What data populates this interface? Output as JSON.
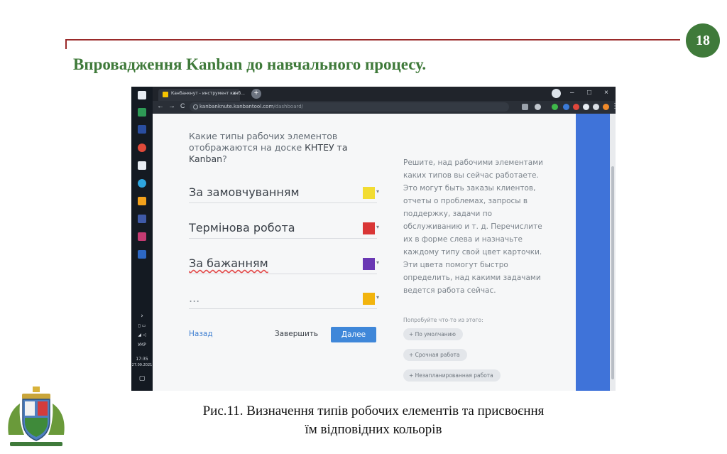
{
  "slide": {
    "number": "18",
    "title": "Впровадження Kanban до навчального процесу.",
    "caption_line1": "Рис.11. Визначення типів робочих елементів та присвоєння",
    "caption_line2": "їм відповідних кольорів"
  },
  "taskbar": {
    "tray_lang": "УКР",
    "clock_time": "17:35",
    "clock_date": "27.09.2021"
  },
  "browser": {
    "tab_title": "Канбанкнут - инструмент канб...",
    "tab_close": "×",
    "new_tab": "+",
    "url_prefix": "kanbanknute.kanbantool.com",
    "url_path": "/dashboard/",
    "controls": {
      "minimize": "–",
      "maximize": "□",
      "close": "×"
    },
    "nav": {
      "back": "←",
      "forward": "→",
      "reload": "C"
    }
  },
  "wizard": {
    "question_part1": "Какие типы рабочих элементов отображаются на доске ",
    "question_board": "КНТЕУ та Kanban",
    "question_end": "?",
    "types": [
      {
        "label": "За замовчуванням",
        "color": "#f2dc32"
      },
      {
        "label": "Термінова робота",
        "color": "#d93636"
      },
      {
        "label": "За бажанням",
        "color": "#6a38b4"
      },
      {
        "label": "...",
        "color": "#f2b40e"
      }
    ],
    "back_label": "Назад",
    "finish_label": "Завершить",
    "next_label": "Далее",
    "help_text": "Решите, над рабочими элементами каких типов вы сейчас работаете. Это могут быть заказы клиентов, отчеты о проблемах, запросы в поддержку, задачи по обслуживанию и т. д. Перечислите их в форме слева и назначьте каждому типу свой цвет карточки. Эти цвета помогут быстро определить, над какими задачами ведется работа сейчас.",
    "try_label": "Попробуйте что-то из этого:",
    "suggestions": [
      "+ По умолчанию",
      "+ Срочная работа",
      "+ Незапланированная работа"
    ]
  },
  "colors": {
    "accent_green": "#3f7a3a",
    "rule_red": "#9a2a2a",
    "next_button": "#3f87d9",
    "side_panel": "#3f73d9"
  }
}
